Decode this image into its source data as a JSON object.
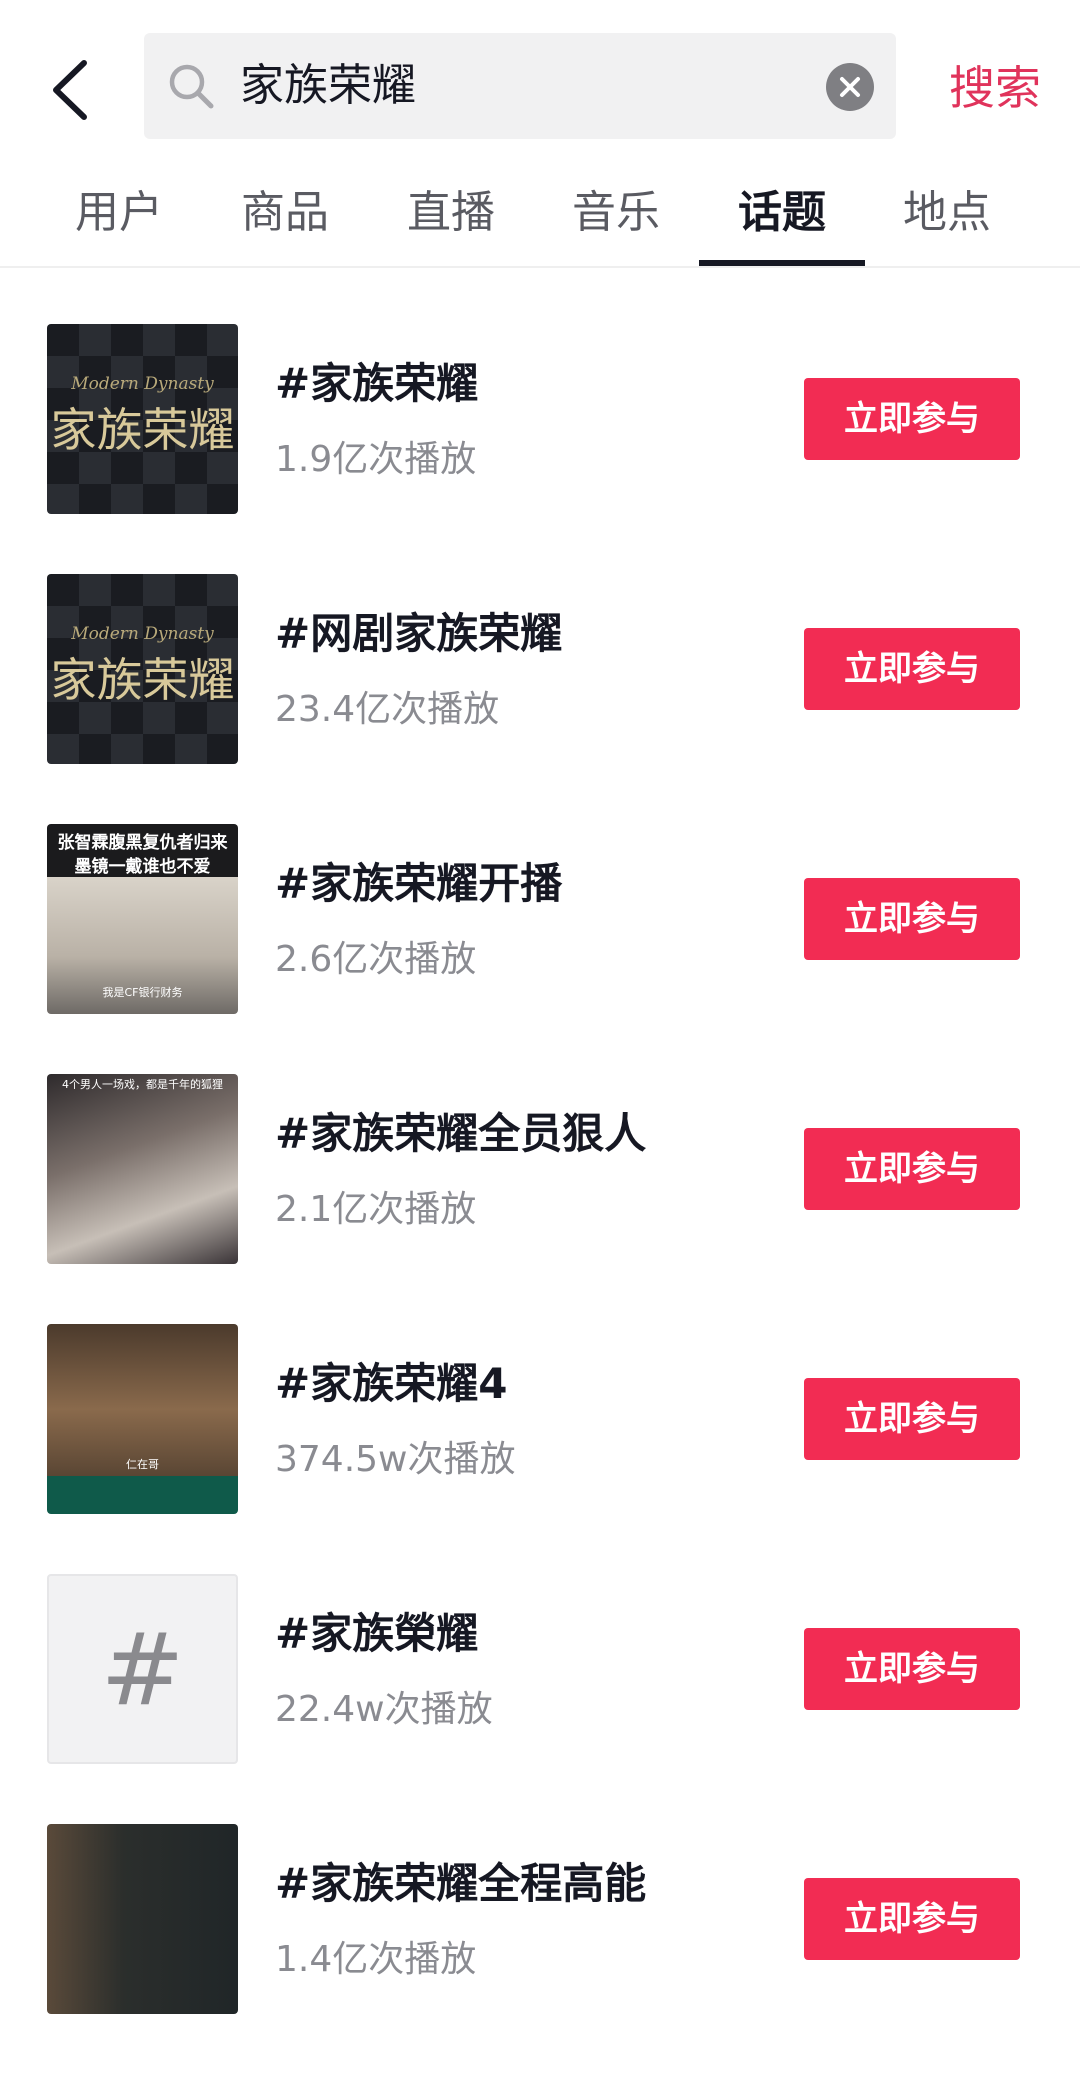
{
  "header": {
    "search_value": "家族荣耀",
    "search_button_label": "搜索"
  },
  "tabs": [
    {
      "label": "用户",
      "active": false
    },
    {
      "label": "商品",
      "active": false
    },
    {
      "label": "直播",
      "active": false
    },
    {
      "label": "音乐",
      "active": false
    },
    {
      "label": "话题",
      "active": true
    },
    {
      "label": "地点",
      "active": false
    }
  ],
  "topics": [
    {
      "title": "#家族荣耀",
      "views": "1.9亿次播放",
      "button": "立即参与",
      "thumb_logo_en": "Modern Dynasty",
      "thumb_logo_cn": "家族荣耀"
    },
    {
      "title": "#网剧家族荣耀",
      "views": "23.4亿次播放",
      "button": "立即参与",
      "thumb_logo_en": "Modern Dynasty",
      "thumb_logo_cn": "家族荣耀"
    },
    {
      "title": "#家族荣耀开播",
      "views": "2.6亿次播放",
      "button": "立即参与",
      "thumb_caption_1": "张智霖腹黑复仇者归来",
      "thumb_caption_2": "墨镜一戴谁也不爱",
      "thumb_sub": "我是CF银行财务"
    },
    {
      "title": "#家族荣耀全员狠人",
      "views": "2.1亿次播放",
      "button": "立即参与",
      "thumb_caption_1": "4个男人一场戏，都是千年的狐狸"
    },
    {
      "title": "#家族荣耀4",
      "views": "374.5w次播放",
      "button": "立即参与",
      "thumb_sub": "仁在哥"
    },
    {
      "title": "#家族榮耀",
      "views": "22.4w次播放",
      "button": "立即参与",
      "thumb_glyph": "#"
    },
    {
      "title": "#家族荣耀全程高能",
      "views": "1.4亿次播放",
      "button": "立即参与"
    }
  ],
  "colors": {
    "accent": "#f22c53",
    "search_text": "#e0335b"
  }
}
